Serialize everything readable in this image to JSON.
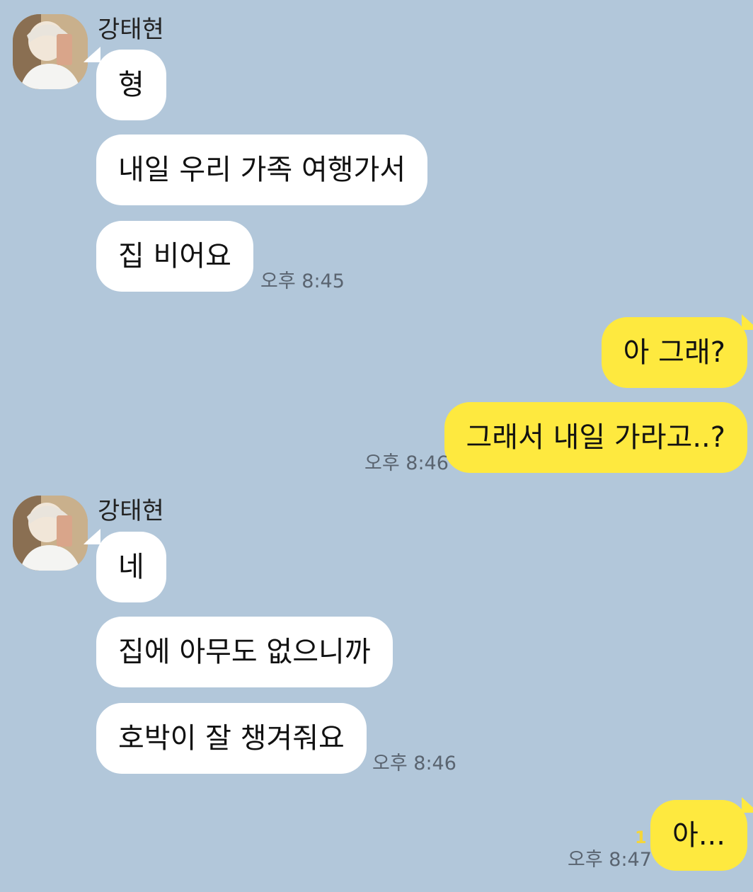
{
  "chat": {
    "messages": [
      {
        "sender": "강태현",
        "direction": "incoming",
        "bubbles": [
          "형",
          "내일 우리 가족 여행가서",
          "집 비어요"
        ],
        "time": "오후 8:45"
      },
      {
        "direction": "outgoing",
        "bubbles": [
          "아 그래?",
          "그래서 내일 가라고..?"
        ],
        "time": "오후 8:46"
      },
      {
        "sender": "강태현",
        "direction": "incoming",
        "bubbles": [
          "네",
          "집에 아무도 없으니까",
          "호박이 잘 챙겨줘요"
        ],
        "time": "오후 8:46"
      },
      {
        "direction": "outgoing",
        "bubbles": [
          "아..."
        ],
        "unread_count": "1",
        "time": "오후 8:47"
      }
    ]
  },
  "colors": {
    "background": "#b2c7da",
    "incoming_bubble": "#ffffff",
    "outgoing_bubble": "#fee93f",
    "unread": "#f5d63a"
  },
  "icons": {
    "avatar": "profile-photo"
  }
}
